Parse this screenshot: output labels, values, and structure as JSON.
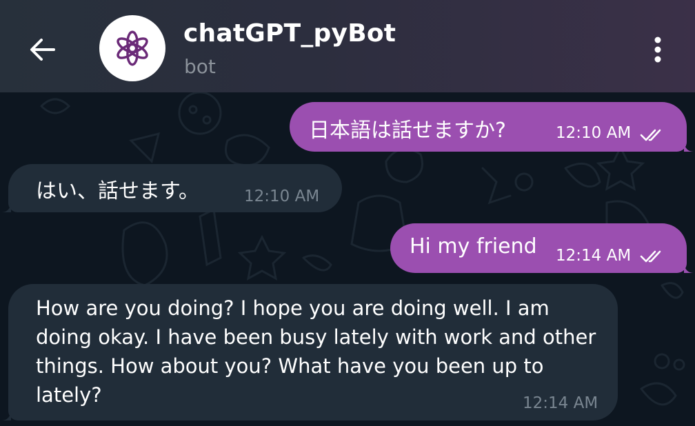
{
  "header": {
    "title": "chatGPT_pyBot",
    "subtitle": "bot",
    "back_icon": "arrow-left-icon",
    "avatar_icon": "openai-logo-icon",
    "menu_icon": "more-vertical-icon"
  },
  "messages": [
    {
      "direction": "outgoing",
      "text": "日本語は話せますか?",
      "time": "12:10 AM",
      "status": "read"
    },
    {
      "direction": "incoming",
      "text": "はい、話せます。",
      "time": "12:10 AM"
    },
    {
      "direction": "outgoing",
      "text": "Hi my friend",
      "time": "12:14 AM",
      "status": "read"
    },
    {
      "direction": "incoming",
      "text": "How are you doing? I hope you are doing well. I am doing okay. I have been busy lately with work and other things. How about you? What have you been up to lately?",
      "time": "12:14 AM"
    }
  ],
  "colors": {
    "outgoing_bubble": "#9b4fb0",
    "incoming_bubble": "#212d39",
    "chat_background": "#0d1620"
  }
}
